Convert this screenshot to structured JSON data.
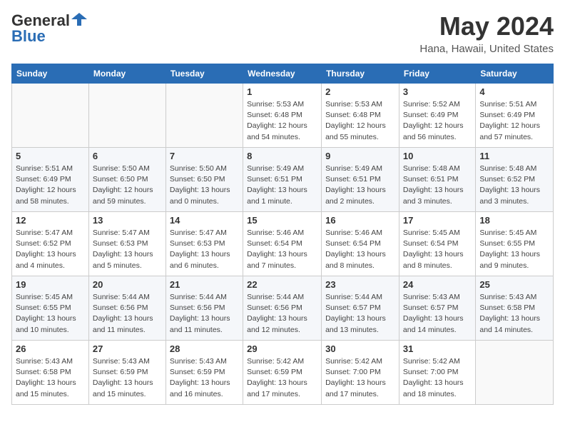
{
  "header": {
    "logo_line1": "General",
    "logo_line2": "Blue",
    "month": "May 2024",
    "location": "Hana, Hawaii, United States"
  },
  "weekdays": [
    "Sunday",
    "Monday",
    "Tuesday",
    "Wednesday",
    "Thursday",
    "Friday",
    "Saturday"
  ],
  "weeks": [
    [
      {
        "day": "",
        "detail": ""
      },
      {
        "day": "",
        "detail": ""
      },
      {
        "day": "",
        "detail": ""
      },
      {
        "day": "1",
        "detail": "Sunrise: 5:53 AM\nSunset: 6:48 PM\nDaylight: 12 hours\nand 54 minutes."
      },
      {
        "day": "2",
        "detail": "Sunrise: 5:53 AM\nSunset: 6:48 PM\nDaylight: 12 hours\nand 55 minutes."
      },
      {
        "day": "3",
        "detail": "Sunrise: 5:52 AM\nSunset: 6:49 PM\nDaylight: 12 hours\nand 56 minutes."
      },
      {
        "day": "4",
        "detail": "Sunrise: 5:51 AM\nSunset: 6:49 PM\nDaylight: 12 hours\nand 57 minutes."
      }
    ],
    [
      {
        "day": "5",
        "detail": "Sunrise: 5:51 AM\nSunset: 6:49 PM\nDaylight: 12 hours\nand 58 minutes."
      },
      {
        "day": "6",
        "detail": "Sunrise: 5:50 AM\nSunset: 6:50 PM\nDaylight: 12 hours\nand 59 minutes."
      },
      {
        "day": "7",
        "detail": "Sunrise: 5:50 AM\nSunset: 6:50 PM\nDaylight: 13 hours\nand 0 minutes."
      },
      {
        "day": "8",
        "detail": "Sunrise: 5:49 AM\nSunset: 6:51 PM\nDaylight: 13 hours\nand 1 minute."
      },
      {
        "day": "9",
        "detail": "Sunrise: 5:49 AM\nSunset: 6:51 PM\nDaylight: 13 hours\nand 2 minutes."
      },
      {
        "day": "10",
        "detail": "Sunrise: 5:48 AM\nSunset: 6:51 PM\nDaylight: 13 hours\nand 3 minutes."
      },
      {
        "day": "11",
        "detail": "Sunrise: 5:48 AM\nSunset: 6:52 PM\nDaylight: 13 hours\nand 3 minutes."
      }
    ],
    [
      {
        "day": "12",
        "detail": "Sunrise: 5:47 AM\nSunset: 6:52 PM\nDaylight: 13 hours\nand 4 minutes."
      },
      {
        "day": "13",
        "detail": "Sunrise: 5:47 AM\nSunset: 6:53 PM\nDaylight: 13 hours\nand 5 minutes."
      },
      {
        "day": "14",
        "detail": "Sunrise: 5:47 AM\nSunset: 6:53 PM\nDaylight: 13 hours\nand 6 minutes."
      },
      {
        "day": "15",
        "detail": "Sunrise: 5:46 AM\nSunset: 6:54 PM\nDaylight: 13 hours\nand 7 minutes."
      },
      {
        "day": "16",
        "detail": "Sunrise: 5:46 AM\nSunset: 6:54 PM\nDaylight: 13 hours\nand 8 minutes."
      },
      {
        "day": "17",
        "detail": "Sunrise: 5:45 AM\nSunset: 6:54 PM\nDaylight: 13 hours\nand 8 minutes."
      },
      {
        "day": "18",
        "detail": "Sunrise: 5:45 AM\nSunset: 6:55 PM\nDaylight: 13 hours\nand 9 minutes."
      }
    ],
    [
      {
        "day": "19",
        "detail": "Sunrise: 5:45 AM\nSunset: 6:55 PM\nDaylight: 13 hours\nand 10 minutes."
      },
      {
        "day": "20",
        "detail": "Sunrise: 5:44 AM\nSunset: 6:56 PM\nDaylight: 13 hours\nand 11 minutes."
      },
      {
        "day": "21",
        "detail": "Sunrise: 5:44 AM\nSunset: 6:56 PM\nDaylight: 13 hours\nand 11 minutes."
      },
      {
        "day": "22",
        "detail": "Sunrise: 5:44 AM\nSunset: 6:56 PM\nDaylight: 13 hours\nand 12 minutes."
      },
      {
        "day": "23",
        "detail": "Sunrise: 5:44 AM\nSunset: 6:57 PM\nDaylight: 13 hours\nand 13 minutes."
      },
      {
        "day": "24",
        "detail": "Sunrise: 5:43 AM\nSunset: 6:57 PM\nDaylight: 13 hours\nand 14 minutes."
      },
      {
        "day": "25",
        "detail": "Sunrise: 5:43 AM\nSunset: 6:58 PM\nDaylight: 13 hours\nand 14 minutes."
      }
    ],
    [
      {
        "day": "26",
        "detail": "Sunrise: 5:43 AM\nSunset: 6:58 PM\nDaylight: 13 hours\nand 15 minutes."
      },
      {
        "day": "27",
        "detail": "Sunrise: 5:43 AM\nSunset: 6:59 PM\nDaylight: 13 hours\nand 15 minutes."
      },
      {
        "day": "28",
        "detail": "Sunrise: 5:43 AM\nSunset: 6:59 PM\nDaylight: 13 hours\nand 16 minutes."
      },
      {
        "day": "29",
        "detail": "Sunrise: 5:42 AM\nSunset: 6:59 PM\nDaylight: 13 hours\nand 17 minutes."
      },
      {
        "day": "30",
        "detail": "Sunrise: 5:42 AM\nSunset: 7:00 PM\nDaylight: 13 hours\nand 17 minutes."
      },
      {
        "day": "31",
        "detail": "Sunrise: 5:42 AM\nSunset: 7:00 PM\nDaylight: 13 hours\nand 18 minutes."
      },
      {
        "day": "",
        "detail": ""
      }
    ]
  ]
}
